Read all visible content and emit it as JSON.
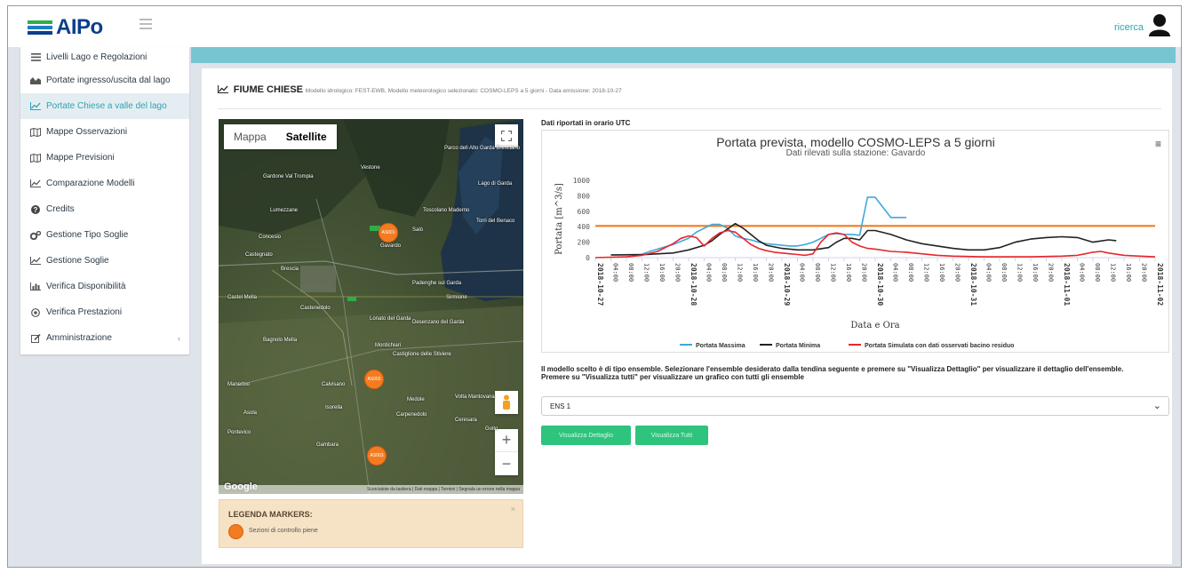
{
  "header": {
    "logo_text": "AIPo",
    "user_link": "ricerca"
  },
  "sidebar": {
    "items": [
      {
        "label": "Livelli Lago e Regolazioni",
        "icon": "list-icon"
      },
      {
        "label": "Portate ingresso/uscita dal lago",
        "icon": "area-chart-icon"
      },
      {
        "label": "Portate Chiese a valle del lago",
        "icon": "line-chart-icon",
        "active": true
      },
      {
        "label": "Mappe Osservazioni",
        "icon": "map-icon"
      },
      {
        "label": "Mappe Previsioni",
        "icon": "map-icon"
      },
      {
        "label": "Comparazione Modelli",
        "icon": "line-chart-icon"
      },
      {
        "label": "Credits",
        "icon": "question-icon"
      },
      {
        "label": "Gestione Tipo Soglie",
        "icon": "gears-icon"
      },
      {
        "label": "Gestione Soglie",
        "icon": "line-chart-icon"
      },
      {
        "label": "Verifica Disponibilità",
        "icon": "bar-chart-icon"
      },
      {
        "label": "Verifica Prestazioni",
        "icon": "target-icon"
      },
      {
        "label": "Amministrazione",
        "icon": "edit-icon",
        "has_submenu": true,
        "caret": "‹"
      }
    ]
  },
  "main": {
    "river": "FIUME CHIESE",
    "subtitle": "Modello idrologico: FEST-EWB, Modello meteorologico selezionato: COSMO-LEPS a 5 giorni - Data emissione: 2018-10-27",
    "utc_note": "Dati riportati in orario UTC",
    "instructions_1": "Il modello scelto è di tipo ensemble. Selezionare l'ensemble desiderato dalla tendina seguente e premere su \"Visualizza Dettaglio\" per visualizzare il dettaglio dell'ensemble.",
    "instructions_2": "Premere su \"Visualizza tutti\" per visualizzare un grafico con tutti gli ensemble",
    "select_value": "ENS 1",
    "btn_detail": "Visualizza Dettaglio",
    "btn_all": "Visualizza Tutti"
  },
  "map": {
    "tab_map": "Mappa",
    "tab_satellite": "Satellite",
    "selected_tab": "Satellite",
    "places": [
      "Vestone",
      "Gardone Val Trompia",
      "Lumezzane",
      "Parco dell Alto Garda Bresciano",
      "Lago di Garda",
      "Toscolano Maderno",
      "Torri del Benaco",
      "Concesio",
      "Gavardo",
      "Salò",
      "Brescia",
      "Castegnato",
      "Castel Mella",
      "Padenghe sul Garda",
      "Sirmione",
      "Desenzano del Garda",
      "Lonato del Garda",
      "Castenedolo",
      "Bagnolo Mella",
      "Montichiari",
      "Castiglione delle Stiviere",
      "Manerbio",
      "Calvisano",
      "Asola",
      "Medole",
      "Volta Mantovana",
      "Isorella",
      "Carpenedolo",
      "Ceresara",
      "Goito",
      "Pontevico",
      "Gambara"
    ],
    "marker_labels": [
      "AS001",
      "AS002",
      "AS003"
    ],
    "footer": "Scorciatoie da tastiera | Dati mappa | Termini | Segnala un errore nella mappa",
    "attribution": "Google"
  },
  "legend": {
    "title": "LEGENDA MARKERS:",
    "item": "Sezioni di controllo piene",
    "close": "×"
  },
  "chart_data": {
    "type": "line",
    "title": "Portata prevista, modello COSMO-LEPS a 5 giorni",
    "subtitle": "Dati rilevati sulla stazione: Gavardo",
    "xlabel": "Data e Ora",
    "ylabel": "Portata [m^3/s]",
    "ylim": [
      0,
      1000
    ],
    "yticks": [
      0,
      200,
      400,
      600,
      800,
      1000
    ],
    "xlim": [
      0,
      144
    ],
    "xticks": [
      "2018-10-27",
      "04:00",
      "08:00",
      "12:00",
      "16:00",
      "20:00",
      "2018-10-28",
      "04:00",
      "08:00",
      "12:00",
      "16:00",
      "20:00",
      "2018-10-29",
      "04:00",
      "08:00",
      "12:00",
      "16:00",
      "20:00",
      "2018-10-30",
      "04:00",
      "08:00",
      "12:00",
      "16:00",
      "20:00",
      "2018-10-31",
      "04:00",
      "08:00",
      "12:00",
      "16:00",
      "20:00",
      "2018-11-01",
      "04:00",
      "08:00",
      "12:00",
      "16:00",
      "20:00",
      "2018-11-02"
    ],
    "threshold": {
      "value": 410,
      "color": "#f47c20"
    },
    "series": [
      {
        "name": "Portata Massima",
        "color": "#3fa8dc",
        "x": [
          4,
          8,
          12,
          14,
          16,
          20,
          24,
          26,
          28,
          30,
          32,
          34,
          36,
          38,
          40,
          42,
          44,
          46,
          48,
          50,
          52,
          54,
          56,
          58,
          60,
          62,
          64,
          66,
          68,
          70,
          72,
          74,
          76,
          80
        ],
        "y": [
          35,
          38,
          42,
          80,
          110,
          170,
          250,
          330,
          380,
          430,
          430,
          380,
          280,
          250,
          230,
          200,
          180,
          170,
          160,
          150,
          150,
          170,
          200,
          250,
          300,
          310,
          300,
          300,
          290,
          780,
          780,
          650,
          520,
          520
        ]
      },
      {
        "name": "Portata Minima",
        "color": "#222222",
        "x": [
          4,
          12,
          20,
          24,
          28,
          30,
          32,
          34,
          36,
          38,
          40,
          42,
          44,
          48,
          52,
          56,
          60,
          62,
          64,
          66,
          68,
          70,
          72,
          76,
          80,
          84,
          88,
          92,
          96,
          100,
          104,
          108,
          112,
          116,
          120,
          124,
          128,
          132,
          134
        ],
        "y": [
          35,
          38,
          60,
          100,
          160,
          220,
          300,
          370,
          440,
          380,
          300,
          220,
          160,
          120,
          100,
          100,
          130,
          200,
          250,
          250,
          230,
          350,
          350,
          300,
          230,
          180,
          150,
          120,
          100,
          100,
          130,
          200,
          240,
          260,
          270,
          260,
          200,
          230,
          220
        ]
      },
      {
        "name": "Portata Simulata con dati osservati bacino residuo",
        "color": "#e8262b",
        "x": [
          0,
          8,
          12,
          16,
          20,
          22,
          24,
          26,
          28,
          30,
          32,
          34,
          36,
          38,
          40,
          42,
          44,
          46,
          48,
          50,
          52,
          54,
          56,
          58,
          60,
          62,
          64,
          66,
          68,
          70,
          72,
          76,
          80,
          84,
          88,
          92,
          96,
          100,
          104,
          108,
          112,
          116,
          120,
          124,
          126,
          128,
          130,
          132,
          136,
          140,
          144
        ],
        "y": [
          0,
          10,
          30,
          80,
          180,
          250,
          280,
          260,
          150,
          250,
          320,
          350,
          330,
          250,
          170,
          120,
          90,
          70,
          60,
          50,
          40,
          30,
          50,
          200,
          300,
          320,
          300,
          200,
          150,
          120,
          110,
          80,
          70,
          50,
          30,
          20,
          15,
          10,
          10,
          10,
          10,
          15,
          20,
          30,
          50,
          70,
          80,
          60,
          30,
          20,
          10
        ]
      }
    ],
    "legend_position": "bottom",
    "grid": false
  }
}
